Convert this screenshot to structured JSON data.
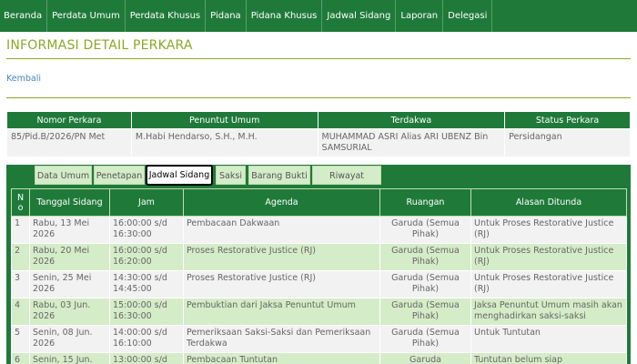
{
  "nav": {
    "items": [
      "Beranda",
      "Perdata Umum",
      "Perdata Khusus",
      "Pidana",
      "Pidana Khusus",
      "Jadwal Sidang",
      "Laporan",
      "Delegasi"
    ]
  },
  "page": {
    "title": "INFORMASI DETAIL PERKARA",
    "back_link": "Kembali"
  },
  "case_info": {
    "headers": [
      "Nomor Perkara",
      "Penuntut Umum",
      "Terdakwa",
      "Status Perkara"
    ],
    "values": [
      "85/Pid.B/2026/PN Met",
      "M.Habi Hendarso, S.H., M.H.",
      "MUHAMMAD ASRI Alias ARI UBENZ Bin SAMSURIAL",
      "Persidangan"
    ]
  },
  "tabs": {
    "items": [
      "Data Umum",
      "Penetapan",
      "Jadwal Sidang",
      "Saksi",
      "Barang Bukti",
      "Riwayat Perkara"
    ],
    "active": "Jadwal Sidang"
  },
  "schedule": {
    "headers": [
      "No",
      "Tanggal Sidang",
      "Jam",
      "Agenda",
      "Ruangan",
      "Alasan Ditunda"
    ],
    "rows": [
      {
        "no": "1",
        "date": "Rabu, 13 Mei 2026",
        "time": "16:00:00 s/d 16:30:00",
        "agenda": "Pembacaan Dakwaan",
        "room": "Garuda (Semua Pihak)",
        "reason": "Untuk Proses Restorative Justice (RJ)"
      },
      {
        "no": "2",
        "date": "Rabu, 20 Mei 2026",
        "time": "16:00:00 s/d 16:20:00",
        "agenda": "Proses Restorative Justice (RJ)",
        "room": "Garuda (Semua Pihak)",
        "reason": "Untuk Proses Restorative Justice (RJ)"
      },
      {
        "no": "3",
        "date": "Senin, 25 Mei 2026",
        "time": "14:30:00 s/d 14:45:00",
        "agenda": "Proses Restorative Justice (RJ)",
        "room": "Garuda (Semua Pihak)",
        "reason": "Untuk Proses Restorative Justice (RJ)"
      },
      {
        "no": "4",
        "date": "Rabu, 03 Jun. 2026",
        "time": "15:00:00 s/d 16:30:00",
        "agenda": "Pembuktian dari Jaksa Penuntut Umum",
        "room": "Garuda (Semua Pihak)",
        "reason": "Jaksa Penuntut Umum masih akan menghadirkan saksi-saksi"
      },
      {
        "no": "5",
        "date": "Senin, 08 Jun. 2026",
        "time": "14:00:00 s/d 16:10:00",
        "agenda": "Pemeriksaan Saksi-Saksi dan Pemeriksaan Terdakwa",
        "room": "Garuda (Semua Pihak)",
        "reason": "Untuk Tuntutan"
      },
      {
        "no": "6",
        "date": "Senin, 15 Jun.",
        "time": "13:00:00 s/d",
        "agenda": "Pembacaan Tuntutan",
        "room": "Garuda",
        "reason": "Tuntutan belum siap"
      }
    ]
  },
  "colors": {
    "nav_green": "#1f7a3a",
    "title_olive": "#8aa828",
    "link_blue": "#4a86b8",
    "row_light": "#f2f2f2",
    "row_green": "#d5ecc8"
  }
}
